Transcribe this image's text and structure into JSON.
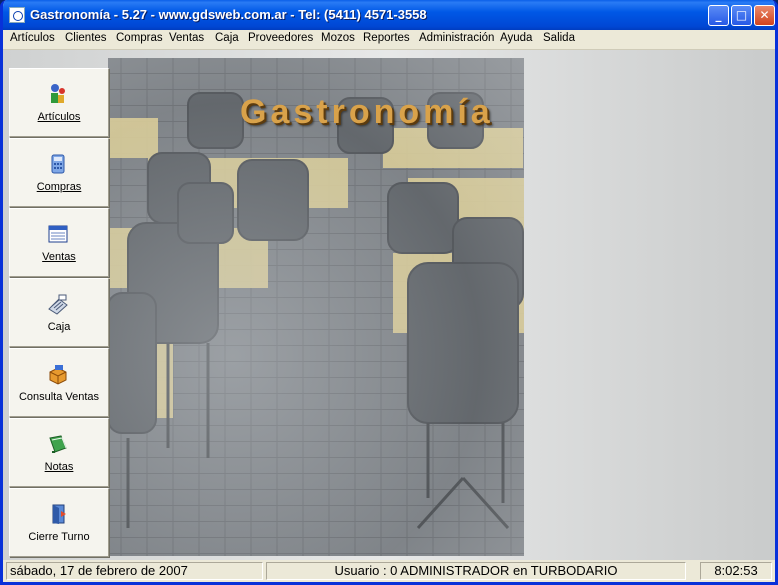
{
  "window": {
    "title": "Gastronomía -  5.27 - www.gdsweb.com.ar - Tel: (5411) 4571-3558"
  },
  "menu": {
    "items": [
      "Artículos",
      "Clientes",
      "Compras",
      "Ventas",
      "Caja",
      "Proveedores",
      "Mozos",
      "Reportes",
      "Administración",
      "Ayuda",
      "Salida"
    ]
  },
  "banner": {
    "brand": "Gastronomía"
  },
  "sidebar": {
    "items": [
      {
        "label": "Artículos",
        "icon": "articulos-icon"
      },
      {
        "label": "Compras",
        "icon": "calculator-icon"
      },
      {
        "label": "Ventas",
        "icon": "calendar-icon"
      },
      {
        "label": "Caja",
        "icon": "cash-register-icon"
      },
      {
        "label": "Consulta  Ventas",
        "icon": "box-icon"
      },
      {
        "label": "Notas",
        "icon": "notebook-icon"
      },
      {
        "label": "Cierre Turno",
        "icon": "door-icon"
      }
    ]
  },
  "status": {
    "date": "sábado, 17 de febrero de 2007",
    "user": "Usuario : 0 ADMINISTRADOR en TURBODARIO",
    "time": "8:02:53"
  },
  "colors": {
    "titlebar": "#0058e6",
    "brand_text": "#d9a24a",
    "menubar": "#ece9d8"
  }
}
